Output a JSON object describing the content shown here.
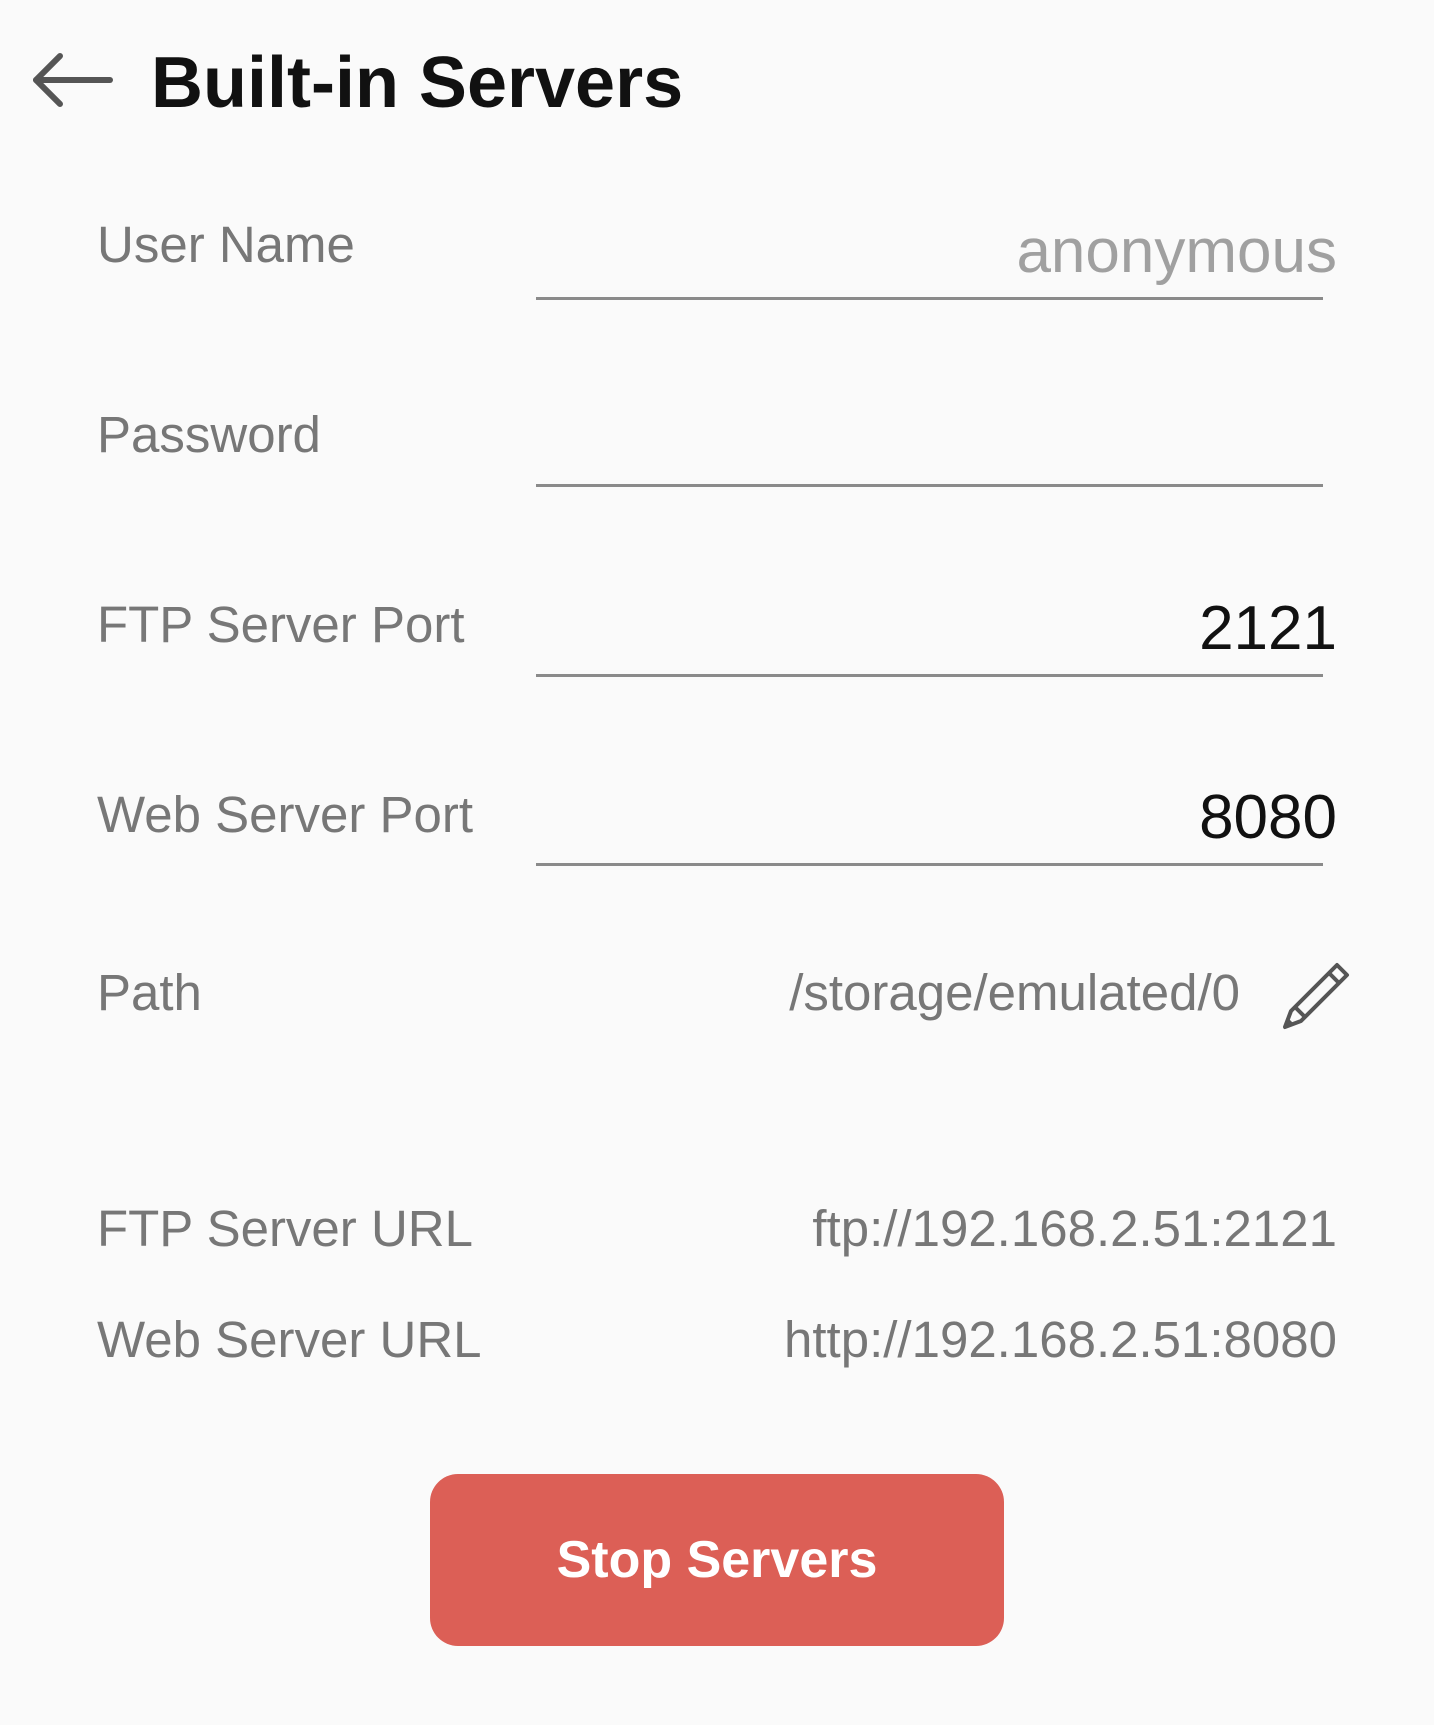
{
  "header": {
    "back_icon": "arrow-left-icon",
    "title": "Built-in Servers"
  },
  "form": {
    "user_name": {
      "label": "User Name",
      "value": "",
      "placeholder": "anonymous"
    },
    "password": {
      "label": "Password",
      "value": "",
      "placeholder": ""
    },
    "ftp_port": {
      "label": "FTP Server Port",
      "value": "2121"
    },
    "web_port": {
      "label": "Web Server Port",
      "value": "8080"
    },
    "path": {
      "label": "Path",
      "value": "/storage/emulated/0",
      "edit_icon": "pencil-icon"
    }
  },
  "urls": {
    "ftp": {
      "label": "FTP Server URL",
      "value": "ftp://192.168.2.51:2121"
    },
    "web": {
      "label": "Web Server URL",
      "value": "http://192.168.2.51:8080"
    }
  },
  "actions": {
    "stop_label": "Stop Servers"
  },
  "colors": {
    "background": "#fafafa",
    "label_text": "#777777",
    "input_text": "#111111",
    "underline": "#8a8a8a",
    "stop_button": "#dc5f56"
  }
}
